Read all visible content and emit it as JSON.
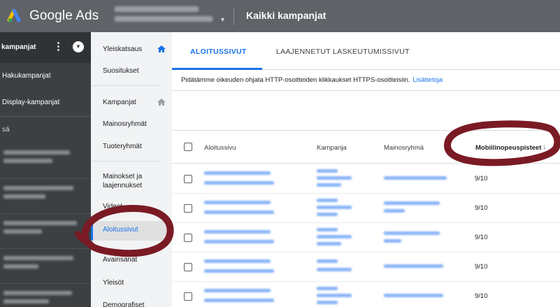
{
  "header": {
    "brand": "Google Ads",
    "page_title": "Kaikki kampanjat"
  },
  "sidebar": {
    "header_label": "kampanjat",
    "items": [
      {
        "label": "Hakukampanjat"
      },
      {
        "label": "Display-kampanjat"
      }
    ],
    "section_label": "sä"
  },
  "nav": {
    "items": [
      {
        "label": "Yleiskatsaus"
      },
      {
        "label": "Suositukset"
      },
      {
        "label": "Kampanjat"
      },
      {
        "label": "Mainosryhmät"
      },
      {
        "label": "Tuoteryhmät"
      },
      {
        "label": "Mainokset ja laajennukset"
      },
      {
        "label": "Videot"
      },
      {
        "label": "Aloitussivut"
      },
      {
        "label": "Avainsanat"
      },
      {
        "label": "Yleisöt"
      },
      {
        "label": "Demografiset"
      }
    ],
    "active": "Aloitussivut"
  },
  "tabs": [
    {
      "label": "ALOITUSSIVUT",
      "active": true
    },
    {
      "label": "LAAJENNETUT LASKEUTUMISSIVUT",
      "active": false
    }
  ],
  "notice": {
    "text": "Pidätämme oikeuden ohjata HTTP-osoitteiden klikkaukset HTTPS-osoitteisiin.",
    "link": "Lisätietoja"
  },
  "table": {
    "columns": [
      "Aloitussivu",
      "Kampanja",
      "Mainosryhmä",
      "Mobiilinopeuspisteet"
    ],
    "sorted_column": "Mobiilinopeuspisteet",
    "rows": [
      {
        "score": "9/10"
      },
      {
        "score": "9/10"
      },
      {
        "score": "9/10"
      },
      {
        "score": "9/10"
      },
      {
        "score": "9/10"
      }
    ]
  },
  "colors": {
    "accent": "#1a73e8",
    "topbar": "#5f6368",
    "sidebar": "#3c4043",
    "annotation": "#7a1a24"
  }
}
